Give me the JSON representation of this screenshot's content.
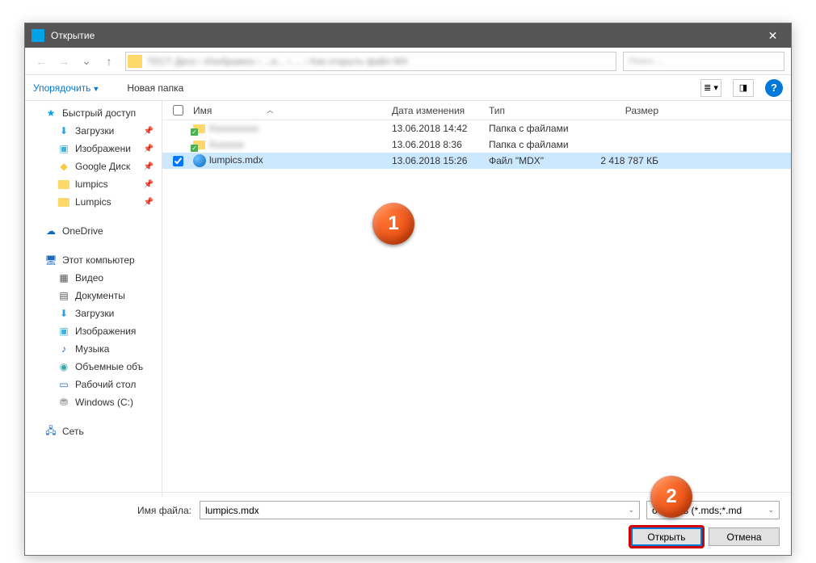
{
  "window": {
    "title": "Открытие",
    "close": "✕"
  },
  "nav": {
    "back": "←",
    "forward": "→",
    "up": "↑",
    "path_blur": "ТЕСТ Диск › Изображен › ...и... › ... ›  Как открыть файл MX",
    "search_blur": "Поиск ..."
  },
  "toolbar": {
    "organize": "Упорядочить",
    "newfolder": "Новая папка",
    "help": "?"
  },
  "sidebar": {
    "quick": "Быстрый доступ",
    "downloads": "Загрузки",
    "pictures": "Изображени",
    "gdrive": "Google Диск",
    "lumpics": "lumpics",
    "lumpics2": "Lumpics",
    "onedrive": "OneDrive",
    "thispc": "Этот компьютер",
    "video": "Видео",
    "documents": "Документы",
    "downloads2": "Загрузки",
    "pictures2": "Изображения",
    "music": "Музыка",
    "objects3d": "Объемные объ",
    "desktop": "Рабочий стол",
    "cdrive": "Windows (C:)",
    "network": "Сеть"
  },
  "columns": {
    "name": "Имя",
    "date": "Дата изменения",
    "type": "Тип",
    "size": "Размер"
  },
  "rows": [
    {
      "name_blur": "Xxxxxxxxxx",
      "date": "13.06.2018 14:42",
      "type": "Папка с файлами",
      "size": ""
    },
    {
      "name_blur": "Xxxxxxx",
      "date": "13.06.2018 8:36",
      "type": "Папка с файлами",
      "size": ""
    },
    {
      "name": "lumpics.mdx",
      "date": "13.06.2018 15:26",
      "type": "Файл \"MDX\"",
      "size": "2 418 787 КБ"
    }
  ],
  "bottom": {
    "filename_label": "Имя файла:",
    "filename_value": "lumpics.mdx",
    "filter": "образов (*.mds;*.md",
    "open": "Открыть",
    "cancel": "Отмена"
  },
  "badges": {
    "one": "1",
    "two": "2"
  }
}
